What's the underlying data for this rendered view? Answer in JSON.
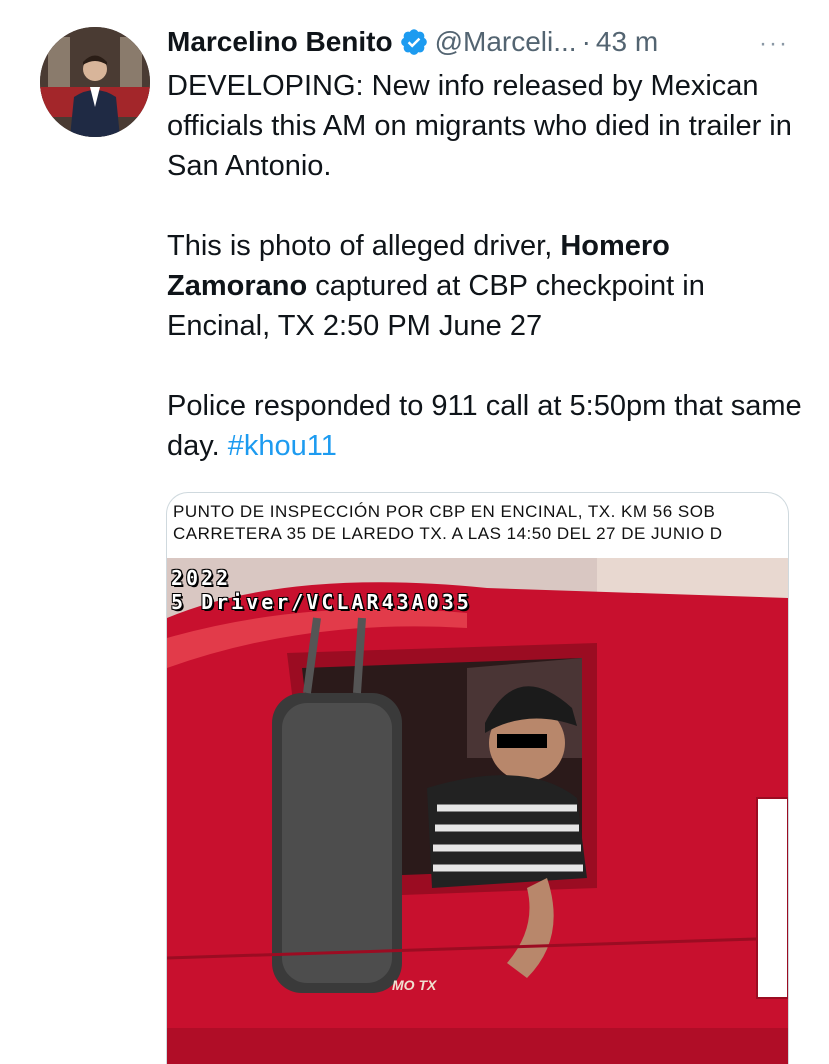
{
  "tweet": {
    "author_name": "Marcelino Benito",
    "handle": "@Marceli...",
    "separator": "·",
    "time": "43 m",
    "more_label": "···",
    "p1": "DEVELOPING: New info released by Mexican officials this AM on migrants who died in trailer in San Antonio.",
    "p2_before": "This is photo of alleged driver, ",
    "p2_bold": "Homero Zamorano",
    "p2_after": " captured at CBP checkpoint in Encinal, TX 2:50 PM June 27",
    "p3_text": "Police responded to 911 call at 5:50pm that same day. ",
    "p3_hashtag": "#khou11"
  },
  "media": {
    "caption_line1": "PUNTO DE INSPECCIÓN POR CBP EN ENCINAL, TX. KM 56 SOB",
    "caption_line2": "CARRETERA 35 DE LAREDO TX. A LAS 14:50 DEL 27 DE JUNIO D",
    "overlay_year": "2022",
    "overlay_id": "5 Driver/VCLAR43A035",
    "truck_text": "MO TX"
  },
  "icons": {
    "verified": "verified-badge-icon",
    "more": "more-options-icon"
  },
  "colors": {
    "accent": "#1d9bf0",
    "text": "#0f1419",
    "secondary": "#536471",
    "truck_red": "#c8102e"
  }
}
